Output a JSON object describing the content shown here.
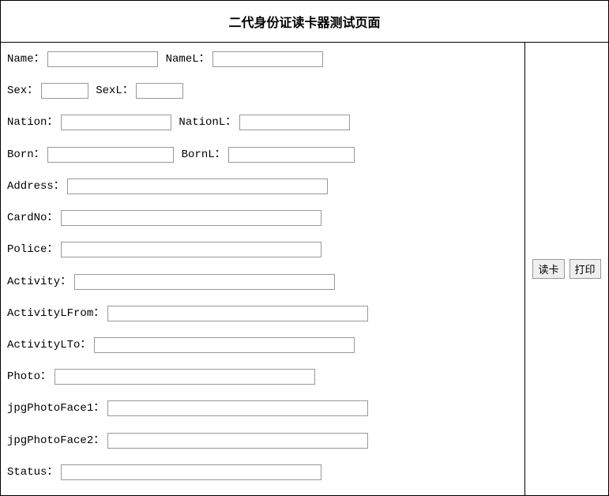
{
  "header": {
    "title": "二代身份证读卡器测试页面"
  },
  "fields": {
    "name_label": "Name：",
    "name_value": "",
    "namel_label": "NameL：",
    "namel_value": "",
    "sex_label": "Sex：",
    "sex_value": "",
    "sexl_label": "SexL：",
    "sexl_value": "",
    "nation_label": "Nation：",
    "nation_value": "",
    "nationl_label": "NationL：",
    "nationl_value": "",
    "born_label": "Born：",
    "born_value": "",
    "bornl_label": "BornL：",
    "bornl_value": "",
    "address_label": "Address：",
    "address_value": "",
    "cardno_label": "CardNo：",
    "cardno_value": "",
    "police_label": "Police：",
    "police_value": "",
    "activity_label": "Activity：",
    "activity_value": "",
    "activitylfrom_label": "ActivityLFrom：",
    "activitylfrom_value": "",
    "activitylto_label": "ActivityLTo：",
    "activitylto_value": "",
    "photo_label": "Photo：",
    "photo_value": "",
    "jpgphotoface1_label": "jpgPhotoFace1：",
    "jpgphotoface1_value": "",
    "jpgphotoface2_label": "jpgPhotoFace2：",
    "jpgphotoface2_value": "",
    "status_label": "Status：",
    "status_value": ""
  },
  "buttons": {
    "read_card": "读卡",
    "print": "打印"
  }
}
